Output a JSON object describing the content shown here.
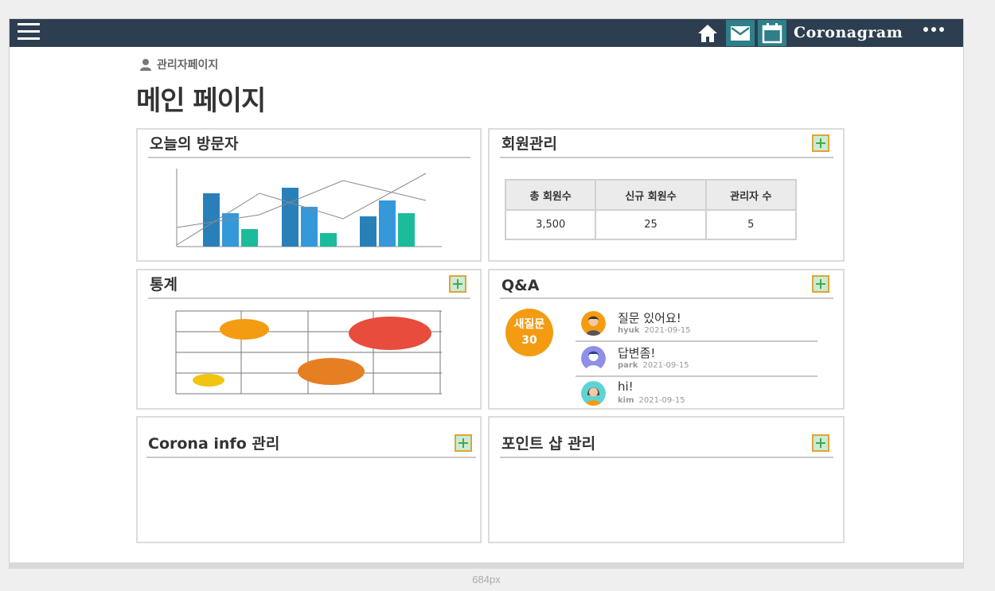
{
  "header": {
    "brand": "Coronagram",
    "icons": [
      "menu-icon",
      "home-icon",
      "mail-icon",
      "calendar-icon",
      "more-icon"
    ],
    "bar_color": "#2c3e50",
    "active_icon_color": "#2f7f8a"
  },
  "breadcrumb": {
    "label": "관리자페이지",
    "icon": "user-icon"
  },
  "page_title": "메인 페이지",
  "visitors": {
    "title": "오늘의 방문자",
    "colors": [
      "#2980b9",
      "#3498db",
      "#1abc9c"
    ]
  },
  "members": {
    "title": "회원관리",
    "columns": [
      "총 회원수",
      "신규 회원수",
      "관리자 수"
    ],
    "values": [
      "3,500",
      "25",
      "5"
    ]
  },
  "stats": {
    "title": "통계",
    "colors": [
      "#f39c12",
      "#e74c3c",
      "#e67e22",
      "#f1c40f"
    ]
  },
  "qna": {
    "title": "Q&A",
    "badge_label": "새질문",
    "badge_count": "30",
    "items": [
      {
        "question": "질문 있어요!",
        "user": "hyuk",
        "date": "2021-09-15",
        "avatar": "man-avatar-icon"
      },
      {
        "question": "답변좀!",
        "user": "park",
        "date": "2021-09-15",
        "avatar": "person-avatar-icon"
      },
      {
        "question": "hi!",
        "user": "kim",
        "date": "2021-09-15",
        "avatar": "woman-avatar-icon"
      }
    ]
  },
  "corona_info": {
    "title": "Corona info 관리"
  },
  "point_shop": {
    "title": "포인트 샵 관리"
  },
  "viewport_label": "684px"
}
